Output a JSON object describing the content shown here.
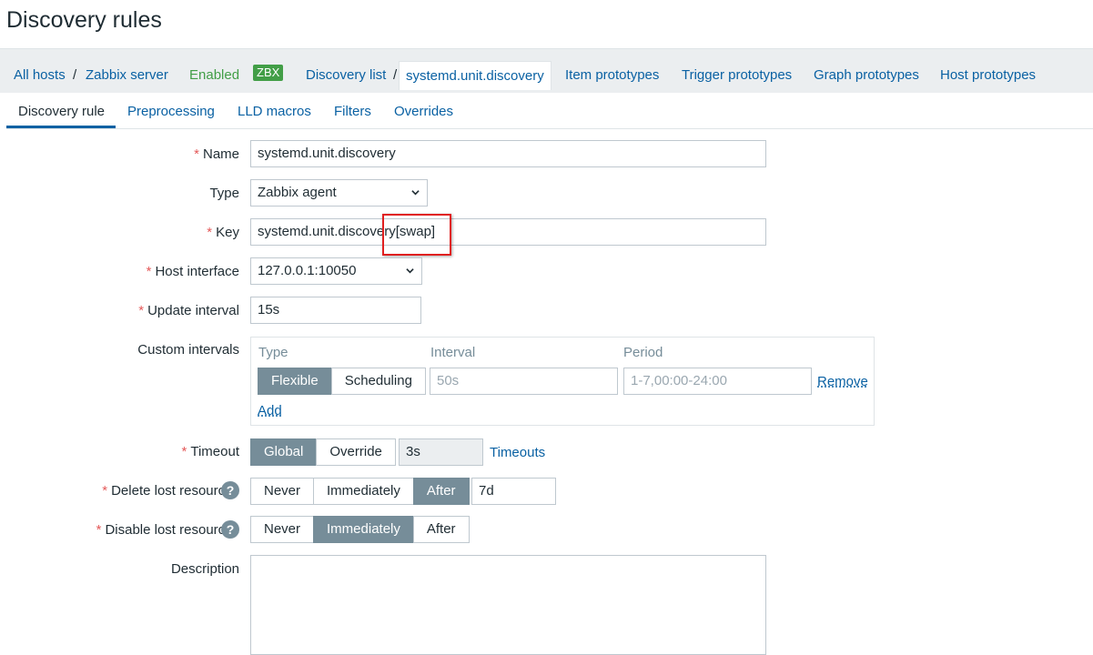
{
  "page_title": "Discovery rules",
  "breadcrumbs": {
    "all_hosts": "All hosts",
    "sep1": "/",
    "host": "Zabbix server",
    "status": "Enabled",
    "zbx_badge": "ZBX",
    "discovery_list": "Discovery list",
    "sep2": "/",
    "current_rule": "systemd.unit.discovery",
    "item_prototypes": "Item prototypes",
    "trigger_prototypes": "Trigger prototypes",
    "graph_prototypes": "Graph prototypes",
    "host_prototypes": "Host prototypes"
  },
  "tabs": [
    {
      "label": "Discovery rule",
      "active": true
    },
    {
      "label": "Preprocessing"
    },
    {
      "label": "LLD macros"
    },
    {
      "label": "Filters"
    },
    {
      "label": "Overrides"
    }
  ],
  "form": {
    "required_mark": "*",
    "name": {
      "label": "Name",
      "value": "systemd.unit.discovery"
    },
    "type": {
      "label": "Type",
      "value": "Zabbix agent"
    },
    "key": {
      "label": "Key",
      "value": "systemd.unit.discovery[swap]"
    },
    "host_interface": {
      "label": "Host interface",
      "value": "127.0.0.1:10050"
    },
    "update_interval": {
      "label": "Update interval",
      "value": "15s"
    },
    "custom_intervals": {
      "label": "Custom intervals",
      "col_type": "Type",
      "col_interval": "Interval",
      "col_period": "Period",
      "type_options": [
        "Flexible",
        "Scheduling"
      ],
      "type_selected": "Flexible",
      "interval_placeholder": "50s",
      "period_placeholder": "1-7,00:00-24:00",
      "remove": "Remove",
      "add": "Add"
    },
    "timeout": {
      "label": "Timeout",
      "options": [
        "Global",
        "Override"
      ],
      "selected": "Global",
      "value": "3s",
      "link": "Timeouts"
    },
    "delete_lost": {
      "label": "Delete lost resources",
      "options": [
        "Never",
        "Immediately",
        "After"
      ],
      "selected": "After",
      "value": "7d"
    },
    "disable_lost": {
      "label": "Disable lost resources",
      "options": [
        "Never",
        "Immediately",
        "After"
      ],
      "selected": "Immediately"
    },
    "help_glyph": "?",
    "description": {
      "label": "Description",
      "value": ""
    }
  },
  "colors": {
    "link": "#0a61a3",
    "enabled_green": "#429e47",
    "segment_active": "#768d99",
    "required_red": "#e45959",
    "highlight_red": "#e02020"
  }
}
